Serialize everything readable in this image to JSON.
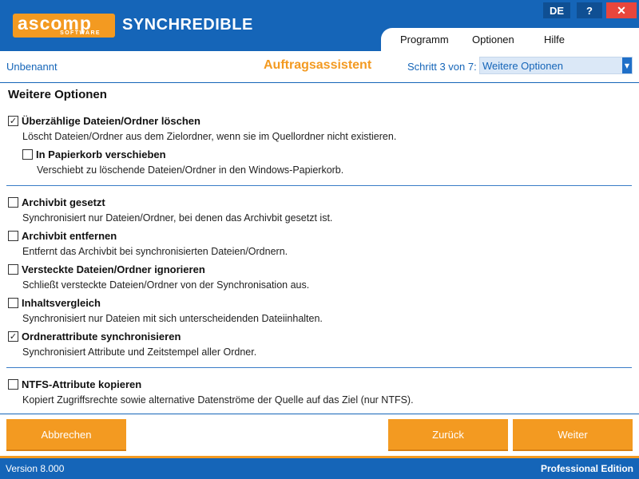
{
  "header": {
    "logo_main": "ascomp",
    "logo_sub": "SOFTWARE",
    "app_title": "SYNCHREDIBLE",
    "lang_button": "DE",
    "help_button": "?",
    "close_button": "✕",
    "menu": [
      "Programm",
      "Optionen",
      "Hilfe"
    ]
  },
  "subheader": {
    "document_name": "Unbenannt",
    "wizard_title": "Auftragsassistent",
    "step_label": "Schritt 3 von 7:",
    "step_select_value": "Weitere Optionen"
  },
  "content": {
    "section_title": "Weitere Optionen",
    "options": [
      {
        "label": "Überzählige Dateien/Ordner löschen",
        "description": "Löscht Dateien/Ordner aus dem Zielordner, wenn sie im Quellordner nicht existieren.",
        "checked": true
      },
      {
        "label": "In Papierkorb verschieben",
        "description": "Verschiebt zu löschende Dateien/Ordner in den Windows-Papierkorb.",
        "checked": false
      },
      {
        "label": "Archivbit gesetzt",
        "description": "Synchronisiert nur Dateien/Ordner, bei denen das Archivbit gesetzt ist.",
        "checked": false
      },
      {
        "label": "Archivbit entfernen",
        "description": "Entfernt das Archivbit bei synchronisierten Dateien/Ordnern.",
        "checked": false
      },
      {
        "label": "Versteckte Dateien/Ordner ignorieren",
        "description": "Schließt versteckte Dateien/Ordner von der Synchronisation aus.",
        "checked": false
      },
      {
        "label": "Inhaltsvergleich",
        "description": "Synchronisiert nur Dateien mit sich unterscheidenden Dateiinhalten.",
        "checked": false
      },
      {
        "label": "Ordnerattribute synchronisieren",
        "description": "Synchronisiert Attribute und Zeitstempel aller Ordner.",
        "checked": true
      },
      {
        "label": "NTFS-Attribute kopieren",
        "description": "Kopiert Zugriffsrechte sowie alternative Datenströme der Quelle auf das Ziel (nur NTFS).",
        "checked": false
      }
    ]
  },
  "footer": {
    "cancel_button": "Abbrechen",
    "back_button": "Zurück",
    "next_button": "Weiter"
  },
  "statusbar": {
    "version": "Version 8.000",
    "edition": "Professional Edition"
  },
  "colors": {
    "brand_blue": "#1565b8",
    "brand_orange": "#f39a21",
    "close_red": "#e9463c"
  }
}
